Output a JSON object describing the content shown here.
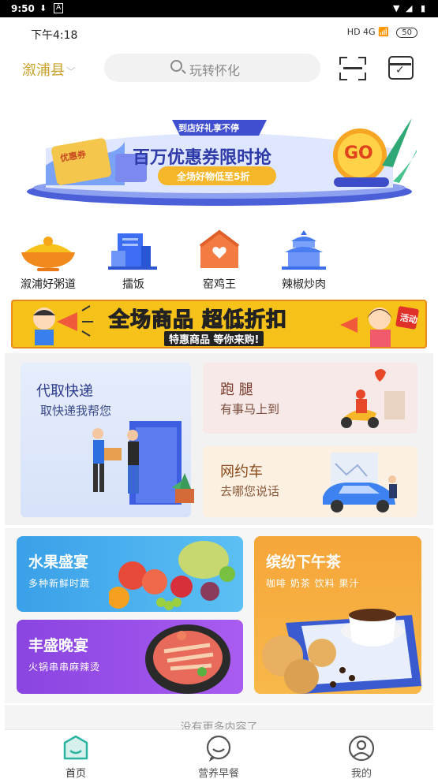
{
  "system_bar": {
    "time": "9:50"
  },
  "status": {
    "time": "下午4:18",
    "network": "HD 4G",
    "battery": "50"
  },
  "header": {
    "location": "溆浦县",
    "search_placeholder": "玩转怀化"
  },
  "banner": {
    "tag": "到店好礼享不停",
    "headline": "百万优惠券限时抢",
    "subline": "全场好物低至5折",
    "go": "GO",
    "coupon_label": "优惠券"
  },
  "categories": [
    {
      "label": "溆浦好粥道",
      "icon": "rice-bowl-icon"
    },
    {
      "label": "擂饭",
      "icon": "building-icon"
    },
    {
      "label": "窑鸡王",
      "icon": "house-heart-icon"
    },
    {
      "label": "辣椒炒肉",
      "icon": "temple-icon"
    }
  ],
  "promo": {
    "headline": "全场商品 超低折扣",
    "subline": "特惠商品 等你来购!",
    "badge": "活动"
  },
  "services": {
    "express": {
      "title": "代取快递",
      "subtitle": "取快递我帮您"
    },
    "errand": {
      "title": "跑 腿",
      "subtitle": "有事马上到"
    },
    "ride": {
      "title": "网约车",
      "subtitle": "去哪您说话"
    }
  },
  "cards": [
    {
      "title": "水果盛宴",
      "subtitle": "多种新鲜时蔬"
    },
    {
      "title": "缤纷下午茶",
      "subtitle": "咖啡 奶茶 饮料 果汁"
    },
    {
      "title": "丰盛晚宴",
      "subtitle": "火锅串串麻辣烫"
    }
  ],
  "footer_text": "没有更多内容了",
  "tabs": [
    {
      "label": "首页",
      "icon": "home-icon",
      "active": true
    },
    {
      "label": "营养早餐",
      "icon": "chat-icon",
      "active": false
    },
    {
      "label": "我的",
      "icon": "user-icon",
      "active": false
    }
  ],
  "colors": {
    "accent": "#2bb5a0",
    "location": "#c9a22c",
    "promo_yellow": "#f6c21a"
  }
}
